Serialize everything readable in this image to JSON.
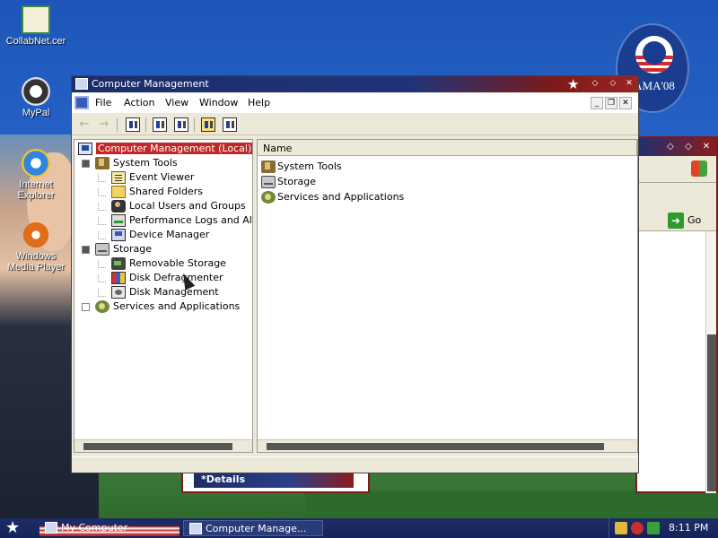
{
  "desktop": {
    "icons": [
      {
        "label": "CollabNet.cer",
        "icon": "certificate-icon"
      },
      {
        "label": "MyPal",
        "icon": "mypal-icon"
      },
      {
        "label": "Internet Explorer",
        "icon": "internet-explorer-icon"
      },
      {
        "label": "Windows Media Player",
        "icon": "media-player-icon"
      }
    ],
    "logo_text": "AMA'08"
  },
  "browser_window": {
    "go_label": "Go"
  },
  "small_window": {
    "title": "*Details"
  },
  "main_window": {
    "title": "Computer Management",
    "title_buttons": [
      "minimize",
      "maximize",
      "close"
    ],
    "menu": [
      "File",
      "Action",
      "View",
      "Window",
      "Help"
    ],
    "toolbar": [
      "back",
      "forward",
      "show-hide-console-tree",
      "properties",
      "export-list",
      "help",
      "show-hide-action-pane"
    ],
    "tree": {
      "root": "Computer Management (Local)",
      "nodes": [
        {
          "label": "System Tools",
          "children": [
            "Event Viewer",
            "Shared Folders",
            "Local Users and Groups",
            "Performance Logs and Alerts",
            "Device Manager"
          ]
        },
        {
          "label": "Storage",
          "children": [
            "Removable Storage",
            "Disk Defragmenter",
            "Disk Management"
          ]
        },
        {
          "label": "Services and Applications",
          "children": []
        }
      ]
    },
    "list": {
      "column": "Name",
      "items": [
        "System Tools",
        "Storage",
        "Services and Applications"
      ]
    }
  },
  "taskbar": {
    "buttons": [
      {
        "label": "My Computer",
        "active": false
      },
      {
        "label": "Computer Manage...",
        "active": true
      }
    ],
    "clock": "8:11 PM"
  },
  "colors": {
    "selection": "#c02828",
    "taskbar": "#1d2d64",
    "title_gradient_start": "#1b2e6a",
    "title_gradient_end": "#9b2424"
  }
}
